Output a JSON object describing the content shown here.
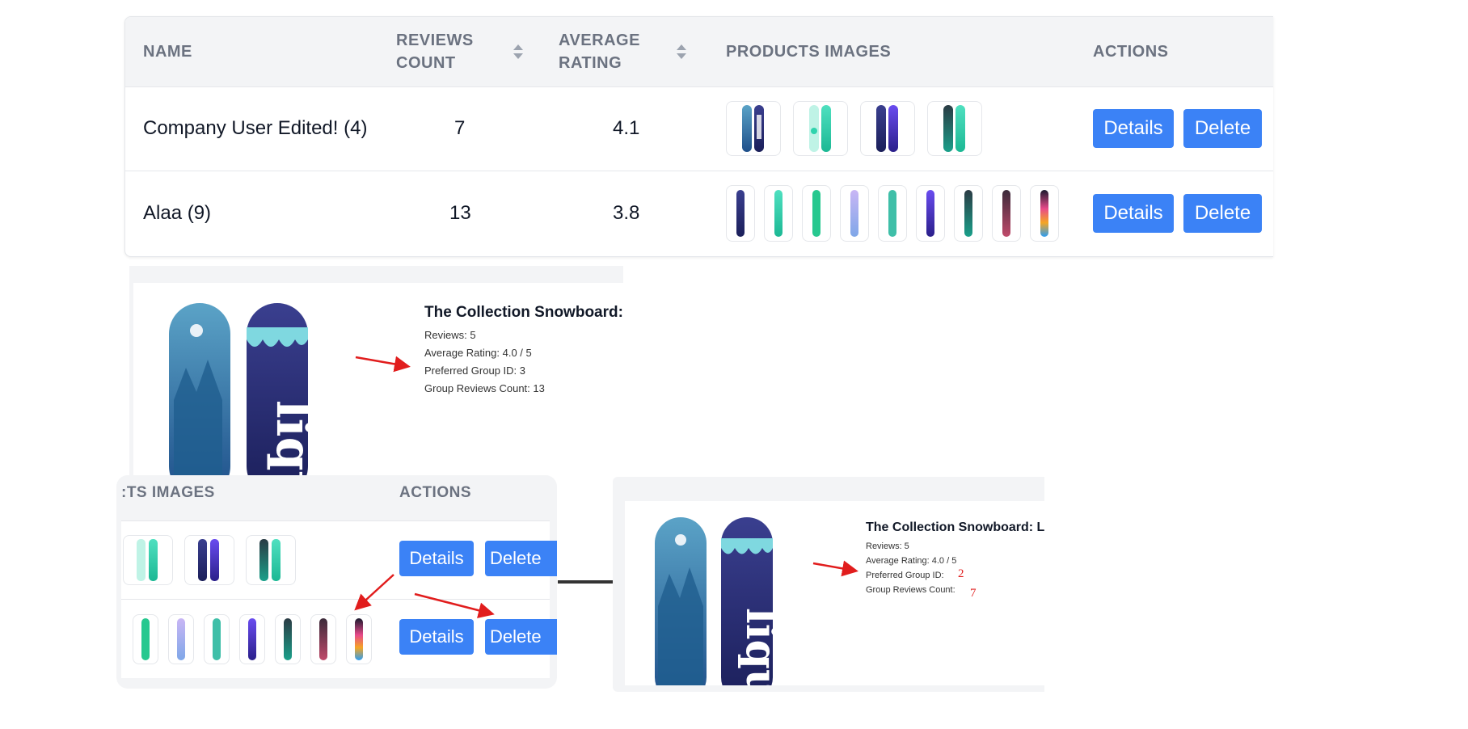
{
  "table": {
    "headers": {
      "name": "NAME",
      "reviews_count_line1": "REVIEWS",
      "reviews_count_line2": "COUNT",
      "average_rating_line1": "AVERAGE",
      "average_rating_line2": "RATING",
      "products_images": "PRODUCTS IMAGES",
      "actions": "ACTIONS"
    },
    "rows": [
      {
        "name": "Company User Edited! (4)",
        "reviews_count": "7",
        "average_rating": "4.1",
        "details_label": "Details",
        "delete_label": "Delete"
      },
      {
        "name": "Alaa (9)",
        "reviews_count": "13",
        "average_rating": "3.8",
        "details_label": "Details",
        "delete_label": "Delete"
      }
    ]
  },
  "detail_before": {
    "title": "The Collection Snowboard: L",
    "reviews": "Reviews: 5",
    "average_rating": "Average Rating: 4.0 / 5",
    "preferred_group": "Preferred Group ID: 3",
    "group_reviews": "Group Reviews Count: 13"
  },
  "small_table": {
    "header_images": ":TS IMAGES",
    "header_actions": "ACTIONS",
    "details_label": "Details",
    "delete_label": "Delete"
  },
  "detail_after": {
    "title": "The Collection Snowboard: Li",
    "reviews": "Reviews: 5",
    "average_rating": "Average Rating: 4.0 / 5",
    "preferred_group_label": "Preferred Group ID:",
    "group_reviews_label": "Group Reviews Count:",
    "preferred_group_value": "2",
    "group_reviews_value": "7"
  },
  "colors": {
    "accent": "#3b82f6",
    "annotation": "#e11d1d",
    "header_bg": "#f3f4f6"
  }
}
